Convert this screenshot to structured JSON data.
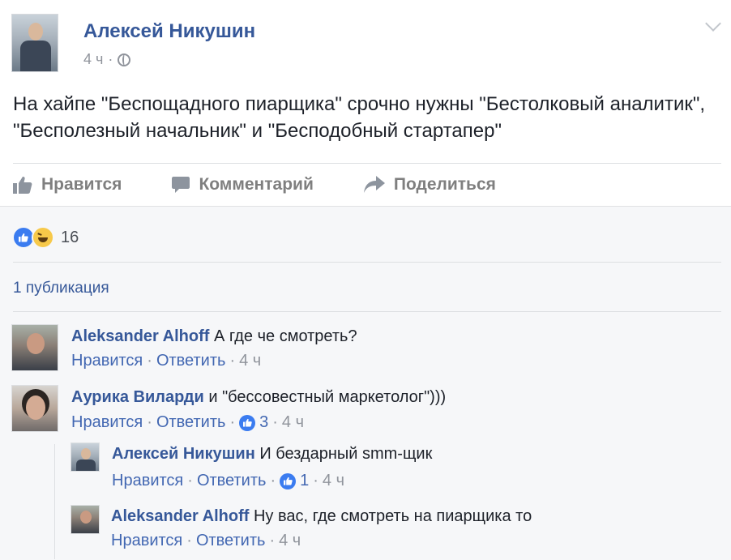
{
  "post": {
    "author": "Алексей Никушин",
    "time": "4 ч",
    "text": "На хайпе \"Беспощадного пиарщика\" срочно нужны \"Бестолковый аналитик\", \"Бесполезный начальник\" и \"Бесподобный стартапер\""
  },
  "actions": {
    "like_label": "Нравится",
    "comment_label": "Комментарий",
    "share_label": "Поделиться"
  },
  "reactions": {
    "count": "16",
    "types": [
      "like-icon",
      "haha-icon"
    ]
  },
  "shares": {
    "label": "1 публикация"
  },
  "comments": [
    {
      "author": "Aleksander Alhoff",
      "text": "А где че смотреть?",
      "like_label": "Нравится",
      "reply_label": "Ответить",
      "likes": "",
      "time": "4 ч"
    },
    {
      "author": "Аурика Виларди",
      "text": "и \"бессовестный маркетолог\")))",
      "like_label": "Нравится",
      "reply_label": "Ответить",
      "likes": "3",
      "time": "4 ч"
    }
  ],
  "replies": [
    {
      "author": "Алексей Никушин",
      "text": "И бездарный smm-щик",
      "like_label": "Нравится",
      "reply_label": "Ответить",
      "likes": "1",
      "time": "4 ч"
    },
    {
      "author": "Aleksander Alhoff",
      "text": "Ну вас, где смотреть на пиарщика то",
      "like_label": "Нравится",
      "reply_label": "Ответить",
      "likes": "",
      "time": "4 ч"
    }
  ],
  "colors": {
    "link": "#365899",
    "meta": "#90949c",
    "like_blue": "#3b7cf0",
    "bg_grey": "#f6f7f9"
  }
}
